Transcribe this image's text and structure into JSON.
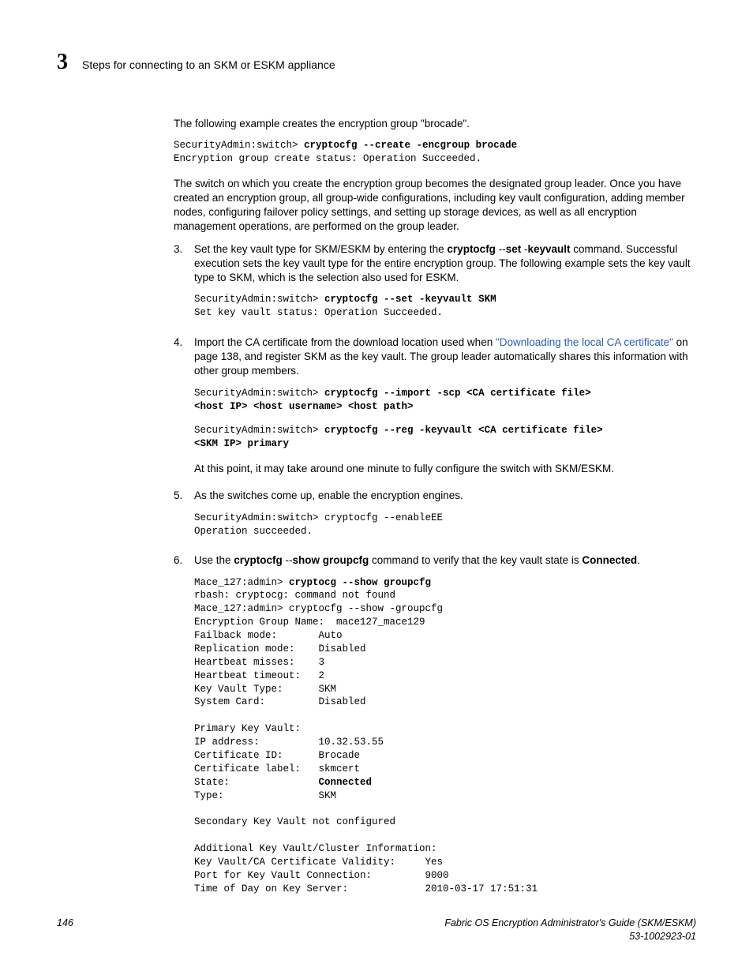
{
  "header": {
    "chapter_number": "3",
    "chapter_title": "Steps for connecting to an SKM or ESKM appliance"
  },
  "intro_para": "The following example creates the encryption group \"brocade\".",
  "code1_prompt": "SecurityAdmin:switch> ",
  "code1_cmd": "cryptocfg --create -encgroup brocade",
  "code1_out": "Encryption group create status: Operation Succeeded.",
  "para2": "The switch on which you create the encryption group becomes the designated group leader. Once you have created an encryption group, all group-wide configurations, including key vault configuration, adding member nodes, configuring failover policy settings, and setting up storage devices, as well as all encryption management operations, are performed on the group leader.",
  "step3": {
    "num": "3.",
    "t1": "Set the key vault type for SKM/ESKM by entering the ",
    "b1": "cryptocfg ",
    "t2": "--",
    "b2": "set ",
    "t3": "-",
    "b3": "keyvault",
    "t4": " command. Successful execution sets the key vault type for the entire encryption group. The following example sets the key vault type to SKM, which is the selection also used for ESKM.",
    "code_prompt": "SecurityAdmin:switch> ",
    "code_cmd": "cryptocfg --set -keyvault SKM",
    "code_out": "Set key vault status: Operation Succeeded."
  },
  "step4": {
    "num": "4.",
    "t1": "Import the CA certificate from the download location used when ",
    "link": "\"Downloading the local CA certificate\"",
    "t2": " on page 138, and register SKM as the key vault. The group leader automatically shares this information with other group members.",
    "code1_prompt": "SecurityAdmin:switch> ",
    "code1_cmd": "cryptocfg --import -scp <CA certificate file> \n<host IP> <host username> <host path>",
    "code2_prompt": "SecurityAdmin:switch> ",
    "code2_cmd": "cryptocfg --reg -keyvault <CA certificate file> \n<SKM IP> primary",
    "after": "At this point, it may take around one minute to fully configure the switch with SKM/ESKM."
  },
  "step5": {
    "num": "5.",
    "text": "As the switches come up, enable the encryption engines.",
    "code": "SecurityAdmin:switch> cryptocfg --enableEE\nOperation succeeded."
  },
  "step6": {
    "num": "6.",
    "t1": "Use the ",
    "b1": "cryptocfg ",
    "t2": "--",
    "b2": "show groupcfg",
    "t3": " command to verify that the key vault state is ",
    "b3": "Connected",
    "t4": ".",
    "code_l1": "Mace_127:admin> ",
    "code_l1b": "cryptocg --show groupcfg",
    "code_rest1": "rbash: cryptocg: command not found\nMace_127:admin> cryptocfg --show -groupcfg\nEncryption Group Name:  mace127_mace129\nFailback mode:       Auto\nReplication mode:    Disabled\nHeartbeat misses:    3\nHeartbeat timeout:   2\nKey Vault Type:      SKM\nSystem Card:         Disabled\n\nPrimary Key Vault:\nIP address:          10.32.53.55\nCertificate ID:      Brocade\nCertificate label:   skmcert",
    "code_state_label": "State:               ",
    "code_state_val": "Connected",
    "code_rest2": "Type:                SKM\n\nSecondary Key Vault not configured\n\nAdditional Key Vault/Cluster Information:\nKey Vault/CA Certificate Validity:     Yes\nPort for Key Vault Connection:         9000\nTime of Day on Key Server:             2010-03-17 17:51:31"
  },
  "footer": {
    "page": "146",
    "title": "Fabric OS Encryption Administrator's Guide (SKM/ESKM)",
    "doc_id": "53-1002923-01"
  }
}
